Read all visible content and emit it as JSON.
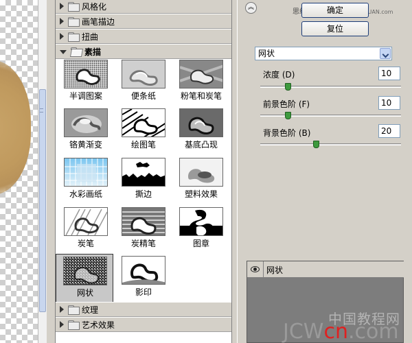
{
  "gallery": {
    "categories": {
      "stylize": "风格化",
      "brush_strokes": "画笔描边",
      "distort": "扭曲",
      "sketch": "素描",
      "texture": "纹理",
      "artistic": "艺术效果"
    },
    "filters": [
      {
        "label": "半调图案"
      },
      {
        "label": "便条纸"
      },
      {
        "label": "粉笔和炭笔"
      },
      {
        "label": "铬黄渐变"
      },
      {
        "label": "绘图笔"
      },
      {
        "label": "基底凸现"
      },
      {
        "label": "水彩画纸"
      },
      {
        "label": "撕边"
      },
      {
        "label": "塑料效果"
      },
      {
        "label": "炭笔"
      },
      {
        "label": "炭精笔"
      },
      {
        "label": "图章"
      },
      {
        "label": "网状",
        "selected": true
      },
      {
        "label": "影印"
      }
    ]
  },
  "panel": {
    "ok_label": "确定",
    "reset_label": "复位",
    "filter_select": "网状",
    "params": [
      {
        "label": "浓度 (D)",
        "value": "10",
        "fraction": 0.2
      },
      {
        "label": "前景色阶 (F)",
        "value": "10",
        "fraction": 0.2
      },
      {
        "label": "背景色阶 (B)",
        "value": "20",
        "fraction": 0.4
      }
    ],
    "layer_name": "网状"
  },
  "watermark": {
    "top_text": "思缘设计论坛",
    "top_url": "www.MISSVUAN.com",
    "bottom_cn": "中国教程网",
    "bottom_en_1": "JCW",
    "bottom_en_red": "cn",
    "bottom_en_2": ".com"
  },
  "colors": {
    "slider_knob": "#3e9a3e",
    "button_border": "#1c3c78",
    "watermark_red": "#e02020"
  }
}
